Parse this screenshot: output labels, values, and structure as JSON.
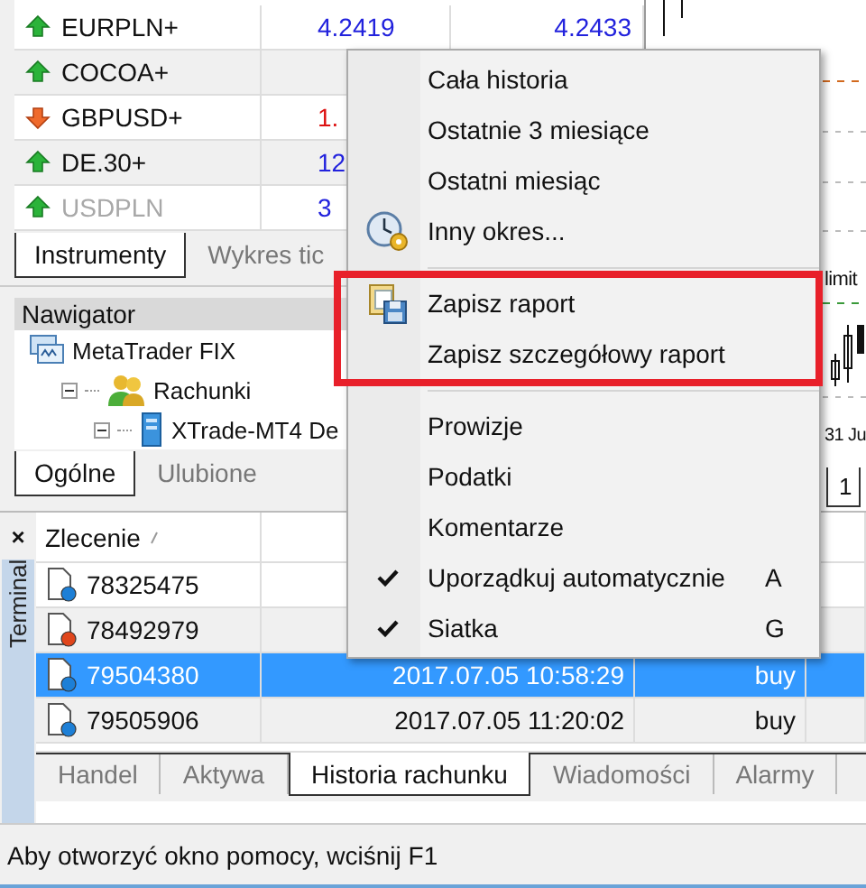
{
  "market_watch": {
    "rows": [
      {
        "symbol": "EURPLN+",
        "falling": false,
        "disabled": false,
        "bid": "4.2419",
        "ask": "4.2433"
      },
      {
        "symbol": "COCOA+",
        "falling": false,
        "disabled": false
      },
      {
        "symbol": "GBPUSD+",
        "falling": true,
        "disabled": false,
        "bid": "1."
      },
      {
        "symbol": "DE.30+",
        "falling": false,
        "disabled": false,
        "bid": "12"
      },
      {
        "symbol": "USDPLN",
        "falling": false,
        "disabled": true,
        "bid": "3"
      }
    ],
    "tabs": [
      {
        "label": "Instrumenty",
        "selected": true
      },
      {
        "label": "Wykres tic",
        "selected": false
      }
    ]
  },
  "navigator": {
    "title": "Nawigator",
    "tree": [
      {
        "label": "MetaTrader FIX",
        "kind": "platform",
        "children": [
          {
            "label": "Rachunki",
            "kind": "accounts",
            "expanded": true,
            "children": [
              {
                "label": "XTrade-MT4 De",
                "kind": "server",
                "expanded": true
              }
            ]
          }
        ]
      }
    ],
    "tabs": [
      {
        "label": "Ogólne",
        "selected": true
      },
      {
        "label": "Ulubione",
        "selected": false
      }
    ]
  },
  "chart": {
    "line_label": "limit",
    "date_label": "31 Ju",
    "tab": "1"
  },
  "terminal": {
    "close": "×",
    "title": "Terminal",
    "columns": [
      "Zlecenie"
    ],
    "rows": [
      {
        "order": "78325475",
        "color": "#1d7fd6",
        "selected": false
      },
      {
        "order": "78492979",
        "color": "#e0461c",
        "selected": false
      },
      {
        "order": "79504380",
        "color": "#1d7fd6",
        "selected": true,
        "time": "2017.07.05 10:58:29",
        "type": "buy"
      },
      {
        "order": "79505906",
        "color": "#1d7fd6",
        "selected": false,
        "time": "2017.07.05 11:20:02",
        "type": "buy"
      }
    ],
    "tabs": [
      {
        "label": "Handel",
        "selected": false
      },
      {
        "label": "Aktywa",
        "selected": false
      },
      {
        "label": "Historia rachunku",
        "selected": true
      },
      {
        "label": "Wiadomości",
        "selected": false
      },
      {
        "label": "Alarmy",
        "selected": false
      }
    ]
  },
  "status_bar": "Aby otworzyć okno pomocy, wciśnij F1",
  "context_menu": {
    "groups": [
      {
        "highlighted": false,
        "items": [
          {
            "label": "Cała historia",
            "kind": "plain"
          },
          {
            "label": "Ostatnie 3 miesiące",
            "kind": "plain"
          },
          {
            "label": "Ostatni miesiąc",
            "kind": "plain"
          },
          {
            "label": "Inny okres...",
            "kind": "clock"
          }
        ]
      },
      {
        "highlighted": true,
        "items": [
          {
            "label": "Zapisz raport",
            "kind": "save"
          },
          {
            "label": "Zapisz szczegółowy raport",
            "kind": "plain"
          }
        ]
      },
      {
        "highlighted": false,
        "items": [
          {
            "label": "Prowizje",
            "kind": "plain"
          },
          {
            "label": "Podatki",
            "kind": "plain"
          },
          {
            "label": "Komentarze",
            "kind": "plain"
          },
          {
            "label": "Uporządkuj automatycznie",
            "kind": "toggle",
            "checked": true,
            "shortcut": "A"
          },
          {
            "label": "Siatka",
            "kind": "toggle",
            "checked": true,
            "shortcut": "G"
          }
        ]
      }
    ]
  }
}
